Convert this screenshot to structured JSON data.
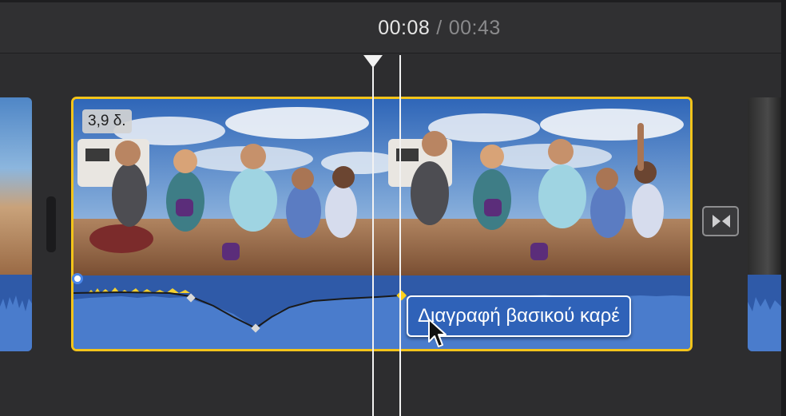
{
  "header": {
    "current_time": "00:08",
    "separator": "/",
    "total_time": "00:43"
  },
  "clip": {
    "duration_label": "3,9 δ."
  },
  "tooltip": {
    "label": "Διαγραφή βασικού καρέ"
  },
  "icons": {
    "transition": "transition-bowtie-icon",
    "cursor": "arrow-cursor-icon",
    "playhead": "playhead-triangle-icon"
  },
  "colors": {
    "selection_border": "#f3c41a",
    "audio_track": "#2f5aa8",
    "waveform": "#4a7ccc",
    "keyframe_active": "#ffd21a"
  }
}
